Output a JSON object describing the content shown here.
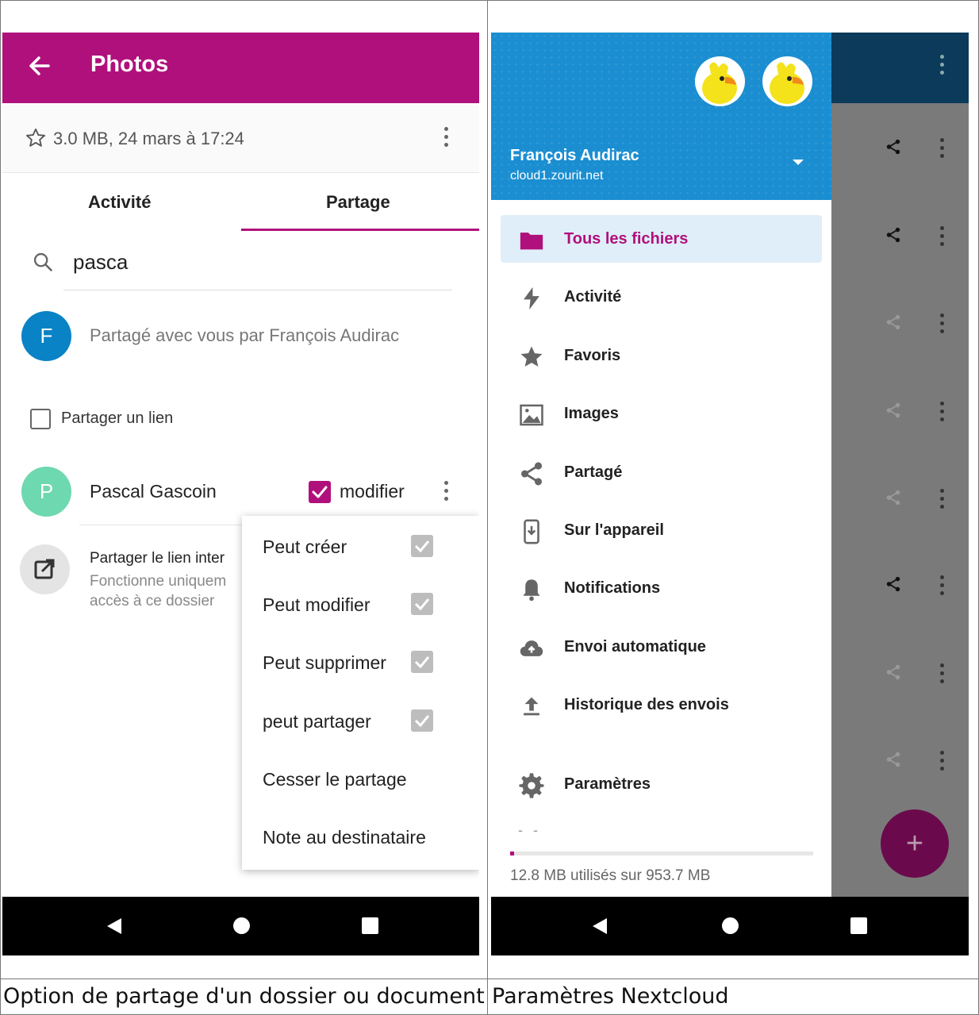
{
  "left_screen": {
    "appbar": {
      "title": "Photos"
    },
    "meta": {
      "text": "3.0 MB, 24 mars à 17:24"
    },
    "tabs": [
      {
        "label": "Activité"
      },
      {
        "label": "Partage"
      }
    ],
    "search": {
      "value": "pasca"
    },
    "shared_by": {
      "avatar_letter": "F",
      "text": "Partagé avec vous par François Audirac",
      "avatar_color": "#0a82c6"
    },
    "share_link": {
      "label": "Partager un lien"
    },
    "share_user": {
      "avatar_letter": "P",
      "name": "Pascal Gascoin",
      "permission_label": "modifier",
      "permission_checked": true,
      "avatar_color": "#6ed8b0"
    },
    "external_link": {
      "title": "Partager le lien inter",
      "subtitle_line1": "Fonctionne uniquem",
      "subtitle_line2": "accès à ce dossier"
    },
    "menu": {
      "items": [
        {
          "label": "Peut créer",
          "checked": true
        },
        {
          "label": "Peut modifier",
          "checked": true
        },
        {
          "label": "Peut supprimer",
          "checked": true
        },
        {
          "label": "peut partager",
          "checked": true
        },
        {
          "label": "Cesser le partage"
        },
        {
          "label": "Note au destinataire"
        }
      ]
    },
    "caption": "Option de partage d'un dossier ou document"
  },
  "right_screen": {
    "drawer": {
      "account_name": "François Audirac",
      "server": "cloud1.zourit.net",
      "items": [
        {
          "label": "Tous les fichiers",
          "icon": "folder-icon",
          "active": true
        },
        {
          "label": "Activité",
          "icon": "lightning-icon"
        },
        {
          "label": "Favoris",
          "icon": "star-icon"
        },
        {
          "label": "Images",
          "icon": "image-icon"
        },
        {
          "label": "Partagé",
          "icon": "share-icon"
        },
        {
          "label": "Sur l'appareil",
          "icon": "device-icon"
        },
        {
          "label": "Notifications",
          "icon": "bell-icon"
        },
        {
          "label": "Envoi automatique",
          "icon": "cloud-upload-icon"
        },
        {
          "label": "Historique des envois",
          "icon": "upload-icon"
        },
        {
          "label": "Paramètres",
          "icon": "gear-icon"
        }
      ],
      "separator": "- -",
      "quota_text": "12.8 MB utilisés sur 953.7 MB",
      "quota_fraction": 0.013
    },
    "fab_label": "+",
    "caption": "Paramètres Nextcloud"
  },
  "colors": {
    "accent": "#b0107c",
    "header_blue": "#1a8ed1"
  }
}
